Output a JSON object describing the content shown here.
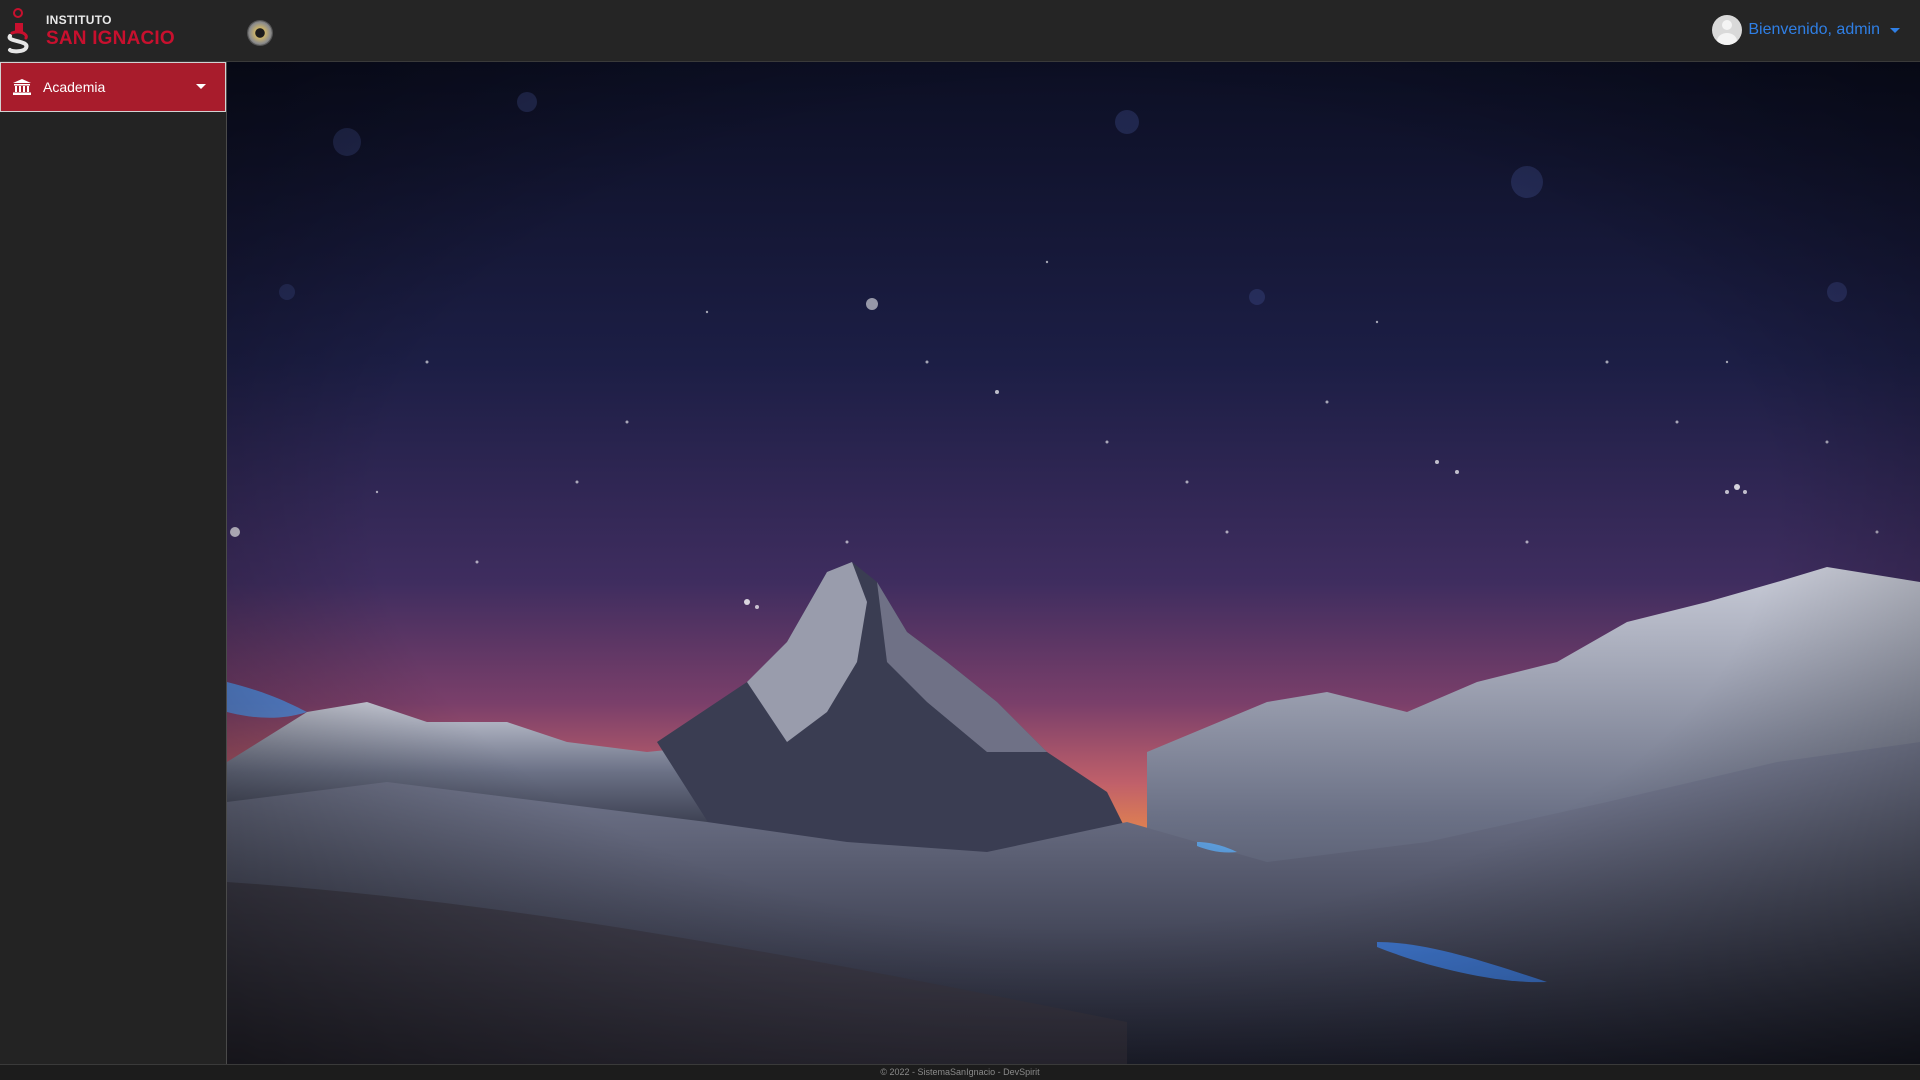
{
  "header": {
    "logo_small": "INSTITUTO",
    "logo_big": "SAN IGNACIO",
    "user_greeting": "Bienvenido, admin",
    "user_avatar_icon": "user-avatar-icon",
    "menu_toggle_icon": "theme-toggle-icon"
  },
  "sidebar": {
    "items": [
      {
        "label": "Academia",
        "icon": "university-icon",
        "active": true
      }
    ]
  },
  "main": {
    "background": "starry-night-mountain-image"
  },
  "footer": {
    "text": "© 2022 - SistemaSanIgnacio - DevSpirit"
  },
  "colors": {
    "accent_red": "#a81c2c",
    "brand_red": "#c8102e",
    "link_blue": "#2f7fe5",
    "topbar": "#252525",
    "sidebar": "#232323"
  }
}
